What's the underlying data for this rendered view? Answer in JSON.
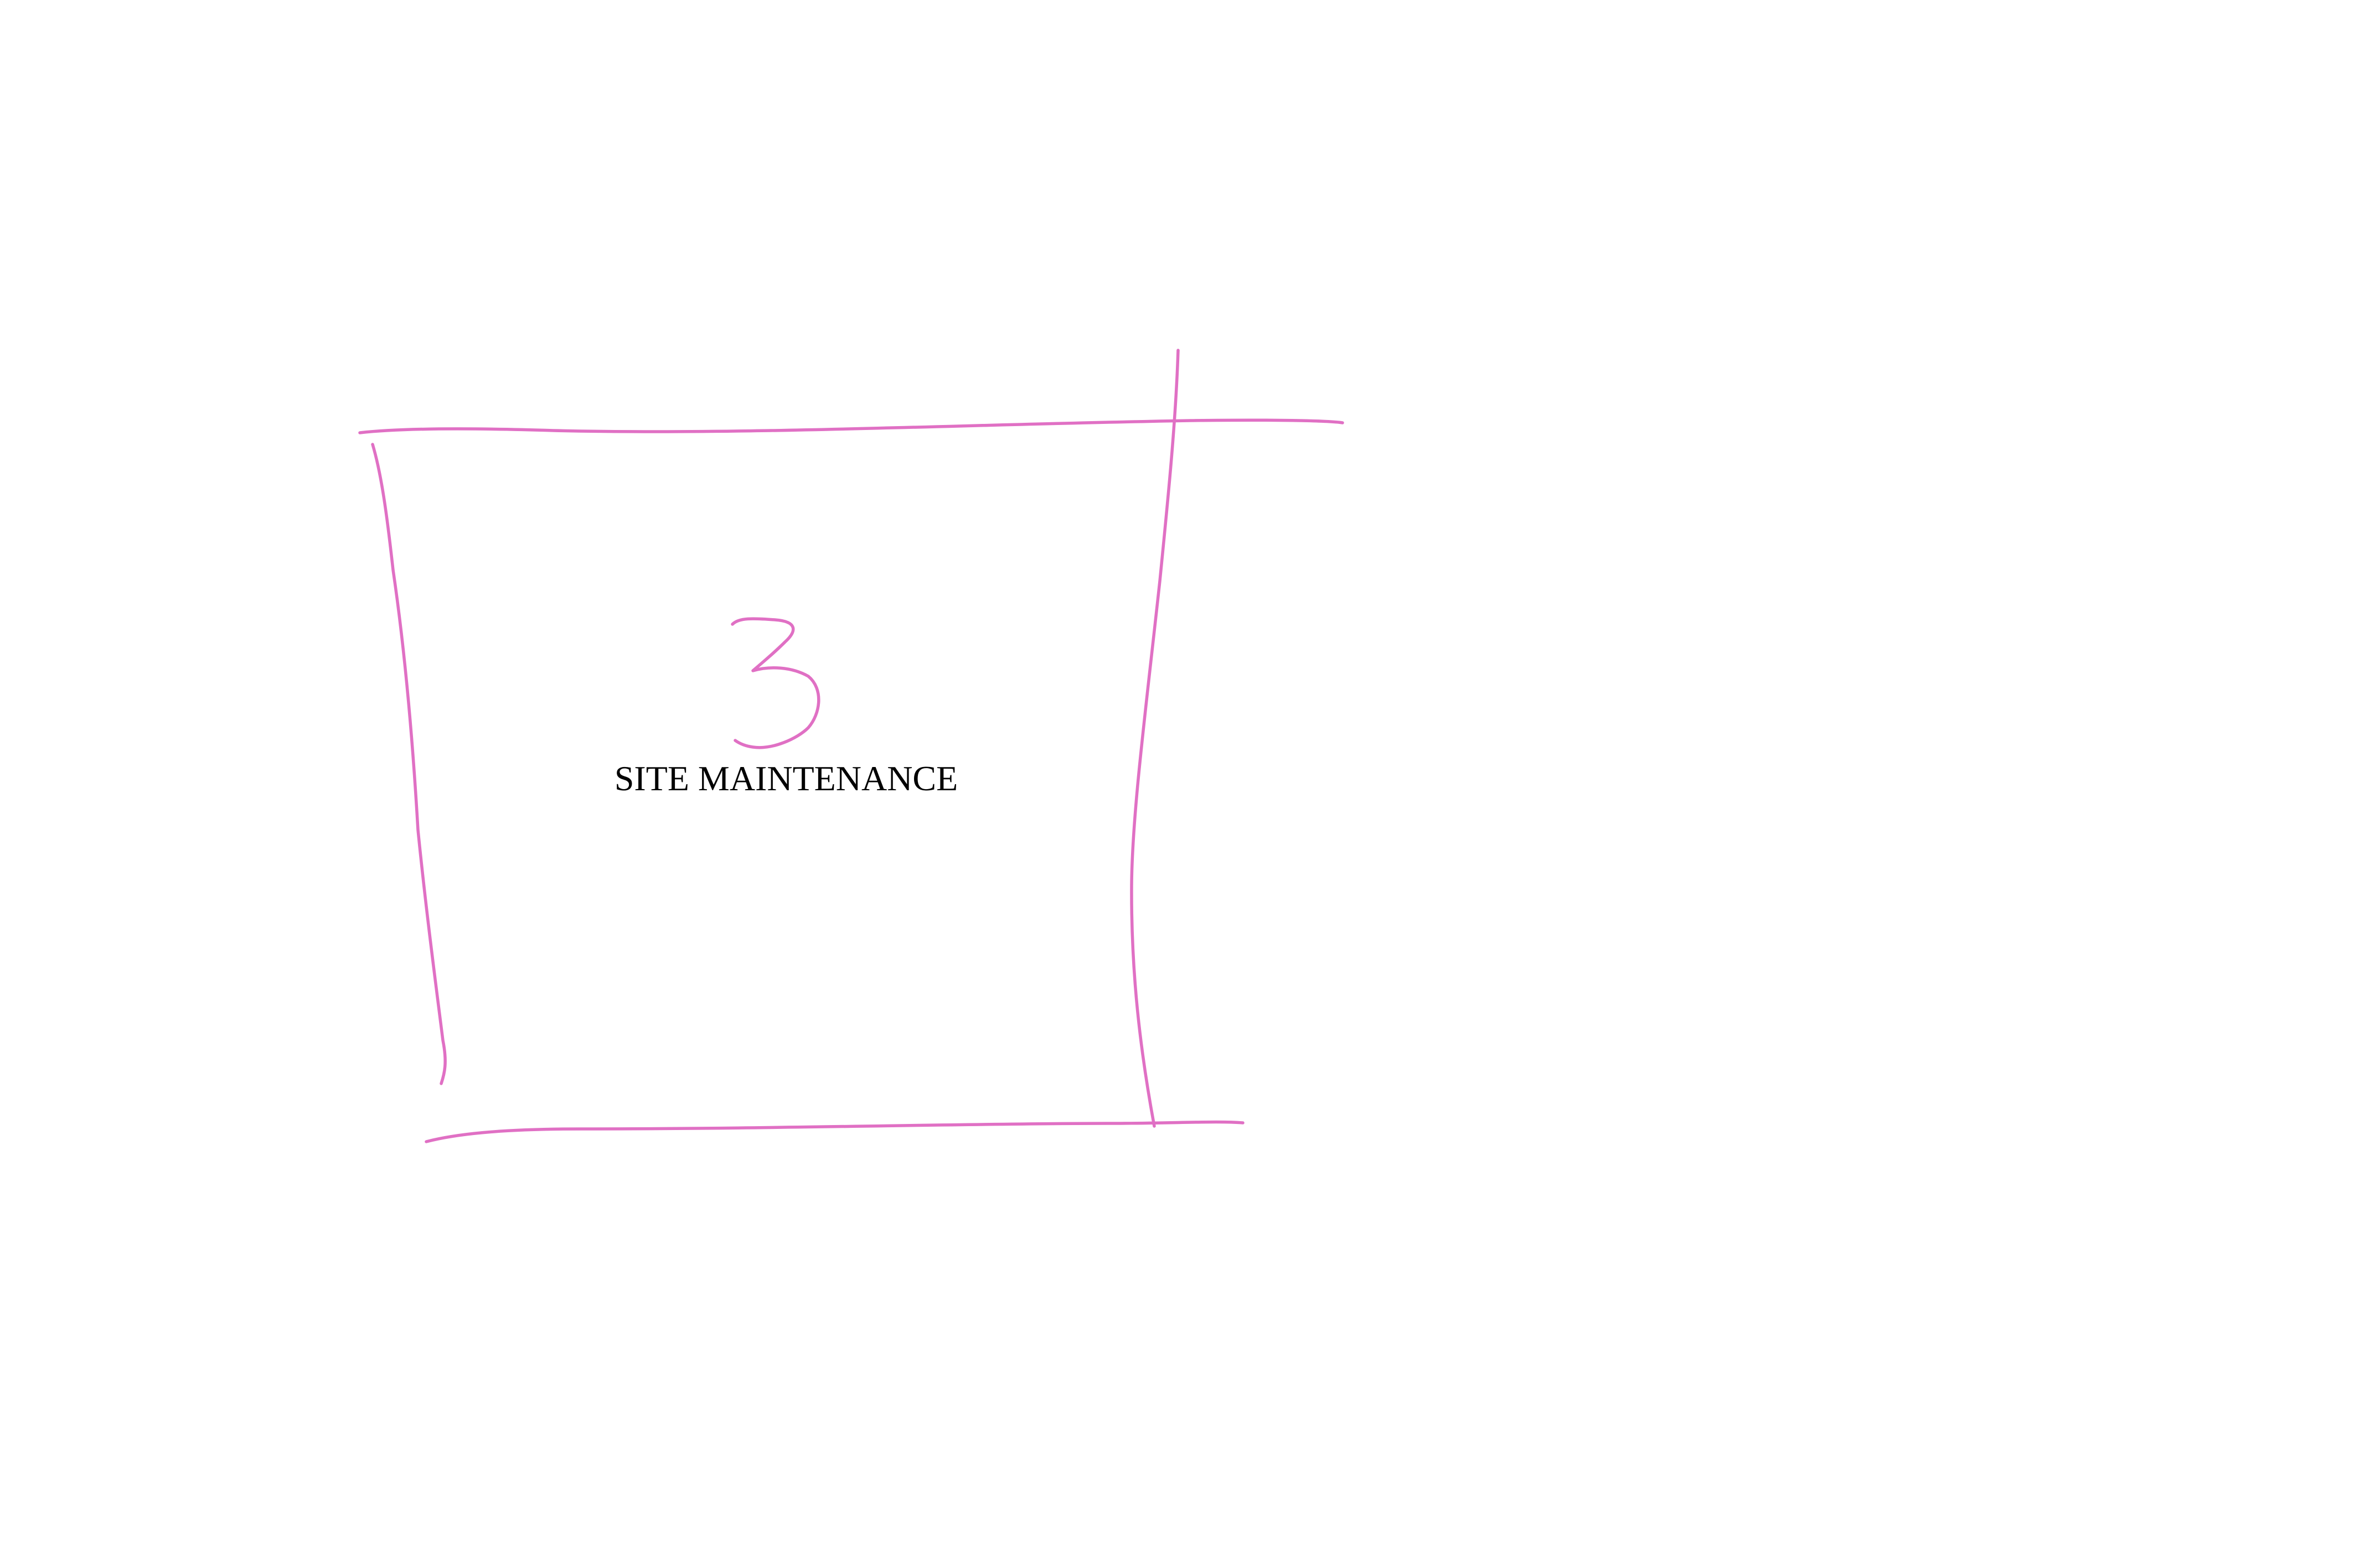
{
  "panel": {
    "number": "3",
    "caption": "SITE MAINTENANCE"
  },
  "colors": {
    "stroke": "#e070c4",
    "text": "#000000",
    "background": "#ffffff"
  }
}
